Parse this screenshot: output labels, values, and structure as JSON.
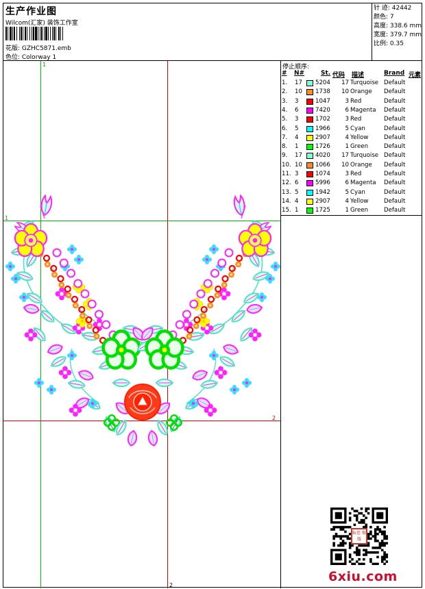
{
  "header": {
    "title": "生产作业图",
    "company": "Wilcom(汇家) 装饰工作室",
    "design_file": "花版:  GZHC5871.emb",
    "colorway": "色位:  Colorway 1"
  },
  "stats": {
    "stitches": "针 迹:  42442",
    "colors": "颜色:  7",
    "height": "高度:  338.6 mm",
    "width": "宽度:  379.7 mm",
    "scale": "比例:  0.35"
  },
  "guides": {
    "v1": "1",
    "h1": "1",
    "h2": "2",
    "v2": "2"
  },
  "stop_sequence": {
    "title": "停止顺序:",
    "headers": {
      "index": "#",
      "needle": "N#",
      "stitches": "St.",
      "code": "代码",
      "description": "描述",
      "brand": "Brand",
      "element": "元素"
    },
    "rows": [
      {
        "index": "1.",
        "needle": "17",
        "color": "#7fffd4",
        "stitches": "5204",
        "code": "17",
        "name": "Turquoise",
        "brand": "Default"
      },
      {
        "index": "2.",
        "needle": "10",
        "color": "#ff8c1a",
        "stitches": "1738",
        "code": "10",
        "name": "Orange",
        "brand": "Default"
      },
      {
        "index": "3.",
        "needle": "3",
        "color": "#ff0000",
        "stitches": "1047",
        "code": "3",
        "name": "Red",
        "brand": "Default"
      },
      {
        "index": "4.",
        "needle": "6",
        "color": "#ff00ff",
        "stitches": "7420",
        "code": "6",
        "name": "Magenta",
        "brand": "Default"
      },
      {
        "index": "5.",
        "needle": "3",
        "color": "#ff0000",
        "stitches": "1702",
        "code": "3",
        "name": "Red",
        "brand": "Default"
      },
      {
        "index": "6.",
        "needle": "5",
        "color": "#00ffff",
        "stitches": "1966",
        "code": "5",
        "name": "Cyan",
        "brand": "Default"
      },
      {
        "index": "7.",
        "needle": "4",
        "color": "#ffff00",
        "stitches": "2907",
        "code": "4",
        "name": "Yellow",
        "brand": "Default"
      },
      {
        "index": "8.",
        "needle": "1",
        "color": "#00ff00",
        "stitches": "1726",
        "code": "1",
        "name": "Green",
        "brand": "Default"
      },
      {
        "index": "9.",
        "needle": "17",
        "color": "#7fffd4",
        "stitches": "4020",
        "code": "17",
        "name": "Turquoise",
        "brand": "Default"
      },
      {
        "index": "10.",
        "needle": "10",
        "color": "#ff8c1a",
        "stitches": "1066",
        "code": "10",
        "name": "Orange",
        "brand": "Default"
      },
      {
        "index": "11.",
        "needle": "3",
        "color": "#ff0000",
        "stitches": "1074",
        "code": "3",
        "name": "Red",
        "brand": "Default"
      },
      {
        "index": "12.",
        "needle": "6",
        "color": "#ff00ff",
        "stitches": "5996",
        "code": "6",
        "name": "Magenta",
        "brand": "Default"
      },
      {
        "index": "13.",
        "needle": "5",
        "color": "#00ffff",
        "stitches": "1942",
        "code": "5",
        "name": "Cyan",
        "brand": "Default"
      },
      {
        "index": "14.",
        "needle": "4",
        "color": "#ffff00",
        "stitches": "2907",
        "code": "4",
        "name": "Yellow",
        "brand": "Default"
      },
      {
        "index": "15.",
        "needle": "1",
        "color": "#00ff00",
        "stitches": "1725",
        "code": "1",
        "name": "Green",
        "brand": "Default"
      }
    ]
  },
  "watermark": {
    "site": "6xiu.com",
    "stamp": "私信 取版"
  }
}
